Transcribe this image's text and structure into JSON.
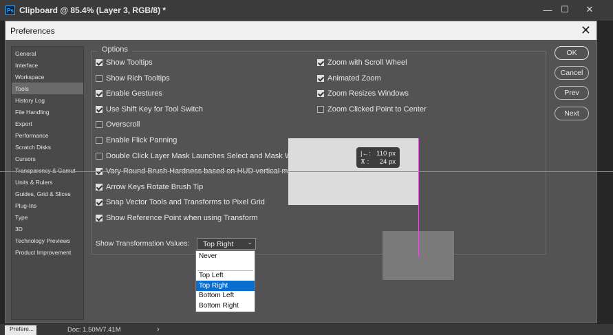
{
  "window": {
    "icon_text": "Ps",
    "title": "Clipboard @ 85.4% (Layer 3, RGB/8) *",
    "minimize": "—",
    "maximize": "☐",
    "close": "✕"
  },
  "dialog": {
    "title": "Preferences",
    "close": "✕",
    "sidebar": [
      {
        "label": "General"
      },
      {
        "label": "Interface"
      },
      {
        "label": "Workspace"
      },
      {
        "label": "Tools",
        "selected": true
      },
      {
        "label": "History Log"
      },
      {
        "label": "File Handling"
      },
      {
        "label": "Export"
      },
      {
        "label": "Performance"
      },
      {
        "label": "Scratch Disks"
      },
      {
        "label": "Cursors"
      },
      {
        "label": "Transparency & Gamut"
      },
      {
        "label": "Units & Rulers"
      },
      {
        "label": "Guides, Grid & Slices"
      },
      {
        "label": "Plug-Ins"
      },
      {
        "label": "Type"
      },
      {
        "label": "3D"
      },
      {
        "label": "Technology Previews"
      },
      {
        "label": "Product Improvement"
      }
    ],
    "options_legend": "Options",
    "options_left": [
      {
        "label": "Show Tooltips",
        "checked": true
      },
      {
        "label": "Show Rich Tooltips",
        "checked": false
      },
      {
        "label": "Enable Gestures",
        "checked": true
      },
      {
        "label": "Use Shift Key for Tool Switch",
        "checked": true
      },
      {
        "label": "Overscroll",
        "checked": false
      },
      {
        "label": "Enable Flick Panning",
        "checked": false
      },
      {
        "label": "Double Click Layer Mask Launches Select and Mask Work",
        "checked": false
      },
      {
        "label": "Vary Round Brush Hardness based on HUD vertical move",
        "checked": true
      },
      {
        "label": "Arrow Keys Rotate Brush Tip",
        "checked": true
      },
      {
        "label": "Snap Vector Tools and Transforms to Pixel Grid",
        "checked": true
      },
      {
        "label": "Show Reference Point when using Transform",
        "checked": true
      }
    ],
    "options_right": [
      {
        "label": "Zoom with Scroll Wheel",
        "checked": true
      },
      {
        "label": "Animated Zoom",
        "checked": true
      },
      {
        "label": "Zoom Resizes Windows",
        "checked": true
      },
      {
        "label": "Zoom Clicked Point to Center",
        "checked": false
      }
    ],
    "transform_values": {
      "label": "Show Transformation Values:",
      "selected": "Top Right",
      "chevron": "⌄",
      "options": [
        "Never",
        "Top Left",
        "Top Right",
        "Bottom Left",
        "Bottom Right"
      ]
    },
    "buttons": {
      "ok": "OK",
      "cancel": "Cancel",
      "prev": "Prev",
      "next": "Next"
    }
  },
  "hud": {
    "x_icon": "|←:",
    "x_value": "110 px",
    "y_icon": "⊼ :",
    "y_value": "24 px"
  },
  "statusbar": {
    "tab": "Prefere...",
    "doc": "Doc: 1.50M/7.41M",
    "arrow": "›"
  },
  "colors": {
    "guide": "#d858d8",
    "selection": "#0a6ed1",
    "dialog_bg": "#535353"
  }
}
